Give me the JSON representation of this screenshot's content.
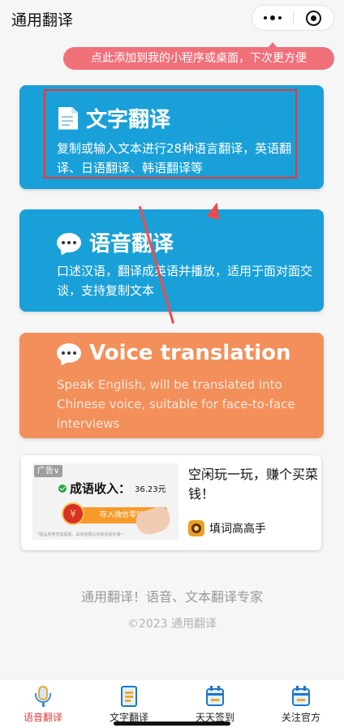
{
  "header": {
    "title": "通用翻译",
    "more_icon": "more-dots-icon",
    "close_icon": "close-target-icon"
  },
  "tip": {
    "text": "点此添加到我的小程序或桌面，下次更方便"
  },
  "cards": {
    "text_translation": {
      "icon": "document-icon",
      "title": "文字翻译",
      "desc": "复制或输入文本进行28种语言翻译，英语翻译、日语翻译、韩语翻译等",
      "color": "#1aa0d8"
    },
    "voice_translation": {
      "icon": "speech-bubble-icon",
      "title": "语音翻译",
      "desc": "口述汉语，翻译成英语并播放，适用于面对面交谈，支持复制文本",
      "color": "#1aa0d8"
    },
    "voice_translation_en": {
      "icon": "speech-bubble-icon",
      "title": "Voice translation",
      "desc": "Speak English, will be translated into Chinese voice, suitable for face-to-face interviews",
      "color": "#f38f5b"
    }
  },
  "ad": {
    "tag": "广告∨",
    "image_headline": "成语收入：",
    "image_amount": "36.23元",
    "image_button": "存入微信零钱",
    "image_coin": "¥",
    "image_fine_print": "*极品奖券奖需提现，具体金额以实际活动为准~",
    "title": "空闲玩一玩，赚个买菜钱！",
    "brand": "填词高高手"
  },
  "footer": {
    "slogan": "通用翻译！语音、文本翻译专家",
    "copyright": "©2023 通用翻译"
  },
  "tabbar": {
    "active_color": "#e33a3a",
    "items": [
      {
        "label": "语音翻译",
        "icon": "microphone-icon",
        "active": true
      },
      {
        "label": "文字翻译",
        "icon": "document-icon",
        "active": false
      },
      {
        "label": "天天签到",
        "icon": "calendar-icon",
        "active": false
      },
      {
        "label": "关注官方",
        "icon": "calendar-icon",
        "active": false
      }
    ]
  }
}
